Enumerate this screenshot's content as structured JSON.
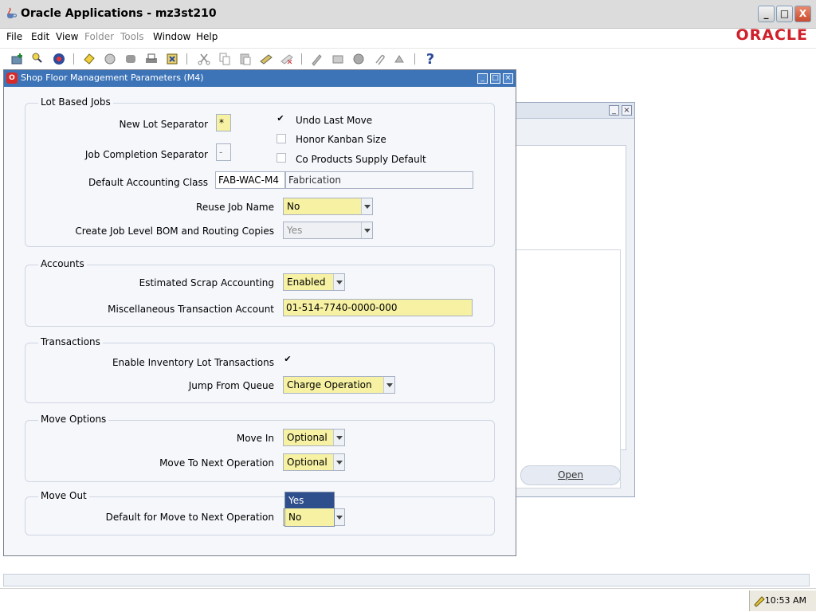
{
  "window": {
    "title": "Oracle Applications - mz3st210",
    "minimize": "_",
    "maximize": "□",
    "close": "X"
  },
  "brand": {
    "logo_text": "ORACLE",
    "logo_color": "#d0202a"
  },
  "menu": {
    "items": [
      {
        "label": "File",
        "enabled": true
      },
      {
        "label": "Edit",
        "enabled": true
      },
      {
        "label": "View",
        "enabled": true
      },
      {
        "label": "Folder",
        "enabled": false
      },
      {
        "label": "Tools",
        "enabled": false
      },
      {
        "label": "Window",
        "enabled": true
      },
      {
        "label": "Help",
        "enabled": true
      }
    ]
  },
  "toolbar": {
    "icons": [
      "new-icon",
      "find-icon",
      "navigator-icon",
      "save-icon",
      "next-step-icon",
      "switch-responsibility-icon",
      "print-icon",
      "close-form-icon",
      "cut-icon",
      "copy-icon",
      "paste-icon",
      "clear-record-icon",
      "delete-record-icon",
      "edit-field-icon",
      "zoom-icon",
      "translations-icon",
      "attachments-icon",
      "folder-tools-icon",
      "help-icon"
    ]
  },
  "background_window": {
    "open_label": "Open"
  },
  "dialog": {
    "title": "Shop Floor Management Parameters (M4)",
    "lot_based_jobs": {
      "title": "Lot Based Jobs",
      "new_lot_separator_label": "New Lot Separator",
      "new_lot_separator_value": "*",
      "job_completion_separator_label": "Job Completion Separator",
      "job_completion_separator_value": "-",
      "undo_last_move_label": "Undo Last Move",
      "undo_last_move_checked": true,
      "honor_kanban_size_label": "Honor Kanban Size",
      "honor_kanban_size_checked": false,
      "co_products_label": "Co Products Supply Default",
      "co_products_checked": false,
      "default_accounting_class_label": "Default Accounting Class",
      "default_accounting_class_value": "FAB-WAC-M4",
      "default_accounting_class_desc": "Fabrication",
      "reuse_job_name_label": "Reuse Job Name",
      "reuse_job_name_value": "No",
      "create_job_level_label": "Create Job Level BOM and Routing Copies",
      "create_job_level_value": "Yes"
    },
    "accounts": {
      "title": "Accounts",
      "est_scrap_label": "Estimated Scrap Accounting",
      "est_scrap_value": "Enabled",
      "misc_txn_label": "Miscellaneous Transaction Account",
      "misc_txn_value": "01-514-7740-0000-000"
    },
    "transactions": {
      "title": "Transactions",
      "enable_lot_txn_label": "Enable Inventory Lot Transactions",
      "enable_lot_txn_checked": true,
      "jump_from_queue_label": "Jump From Queue",
      "jump_from_queue_value": "Charge Operation"
    },
    "move_options": {
      "title": "Move Options",
      "move_in_label": "Move In",
      "move_in_value": "Optional",
      "move_to_next_label": "Move To Next Operation",
      "move_to_next_value": "Optional"
    },
    "move_out": {
      "title": "Move Out",
      "default_move_label": "Default for Move to Next Operation",
      "default_move_value": "No",
      "dropdown_options": [
        "Yes",
        "No"
      ],
      "dropdown_highlighted": "Yes"
    }
  },
  "taskbar": {
    "clock": "10:53 AM"
  },
  "colors": {
    "dialog_title_bar": "#3d74b8",
    "required_field": "#f7f2a3",
    "highlight": "#2e4f8c"
  }
}
